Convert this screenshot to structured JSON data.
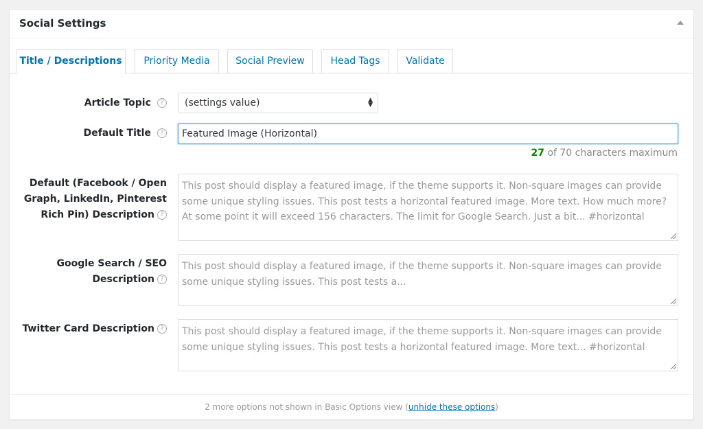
{
  "panel": {
    "title": "Social Settings"
  },
  "tabs": [
    {
      "label": "Title / Descriptions",
      "active": true
    },
    {
      "label": "Priority Media"
    },
    {
      "label": "Social Preview"
    },
    {
      "label": "Head Tags"
    },
    {
      "label": "Validate"
    }
  ],
  "fields": {
    "article_topic": {
      "label": "Article Topic",
      "value": "(settings value)"
    },
    "default_title": {
      "label": "Default Title",
      "value": "Featured Image (Horizontal)",
      "count": "27",
      "count_suffix": "of 70 characters maximum"
    },
    "default_description": {
      "label_line1": "Default (Facebook / Open",
      "label_line2": "Graph, LinkedIn, Pinterest",
      "label_line3": "Rich Pin) Description",
      "placeholder": "This post should display a featured image, if the theme supports it. Non-square images can provide some unique styling issues. This post tests a horizontal featured image. More text. How much more? At some point it will exceed 156 characters. The limit for Google Search. Just a bit... #horizontal"
    },
    "seo_description": {
      "label_line1": "Google Search / SEO",
      "label_line2": "Description",
      "placeholder": "This post should display a featured image, if the theme supports it. Non-square images can provide some unique styling issues. This post tests a..."
    },
    "twitter_description": {
      "label": "Twitter Card Description",
      "placeholder": "This post should display a featured image, if the theme supports it. Non-square images can provide some unique styling issues. This post tests a horizontal featured image. More text... #horizontal"
    }
  },
  "footer": {
    "text": "2 more options not shown in Basic Options view (",
    "link": "unhide these options",
    "text_end": ")"
  },
  "icons": {
    "help": "question-circle-icon",
    "collapse": "triangle-up-icon"
  },
  "colors": {
    "accent": "#0073aa",
    "count_ok": "#008000",
    "focus_border": "#5b9dd9"
  }
}
